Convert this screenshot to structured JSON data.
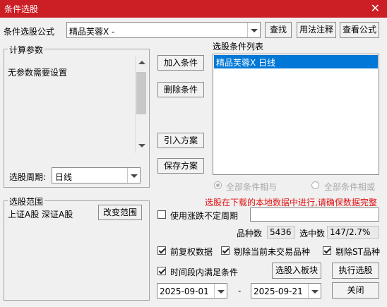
{
  "window": {
    "title": "条件选股",
    "close_glyph": "✕"
  },
  "formula": {
    "label": "条件选股公式",
    "value": "精品芙蓉X  -"
  },
  "buttons": {
    "find": "查找",
    "usage": "用法注释",
    "view": "查看公式",
    "add": "加入条件",
    "delete": "删除条件",
    "import": "引入方案",
    "save": "保存方案",
    "change_range": "改变范围",
    "to_block": "选股入板块",
    "execute": "执行选股",
    "close": "关闭"
  },
  "params": {
    "group_label": "计算参数",
    "text": "无参数需要设置"
  },
  "period": {
    "label": "选股周期:",
    "value": "日线"
  },
  "conditions": {
    "label": "选股条件列表",
    "items": [
      "精品芙蓉X  日线"
    ]
  },
  "logic": {
    "and_label": "全部条件相与",
    "or_label": "全部条件相或"
  },
  "range": {
    "group_label": "选股范围",
    "value": "上证A股 深证A股"
  },
  "notice": "选股在下载的本地数据中进行,请确保数据完整",
  "options": {
    "variable_period": "使用涨跌不定周期",
    "adjusted": "前复权数据",
    "exclude_untraded": "剔除当前未交易品种",
    "exclude_st": "剔除ST品种",
    "time_range": "时间段内满足条件"
  },
  "stats": {
    "count_label": "品种数",
    "count_value": "5436",
    "selected_label": "选中数",
    "selected_value": "147/2.7%"
  },
  "dates": {
    "start": "2025-09-01",
    "separator": "-",
    "end": "2025-09-21"
  },
  "colors": {
    "title_bar": "#cc1e25",
    "selection": "#0078d7",
    "notice": "#e01010"
  }
}
